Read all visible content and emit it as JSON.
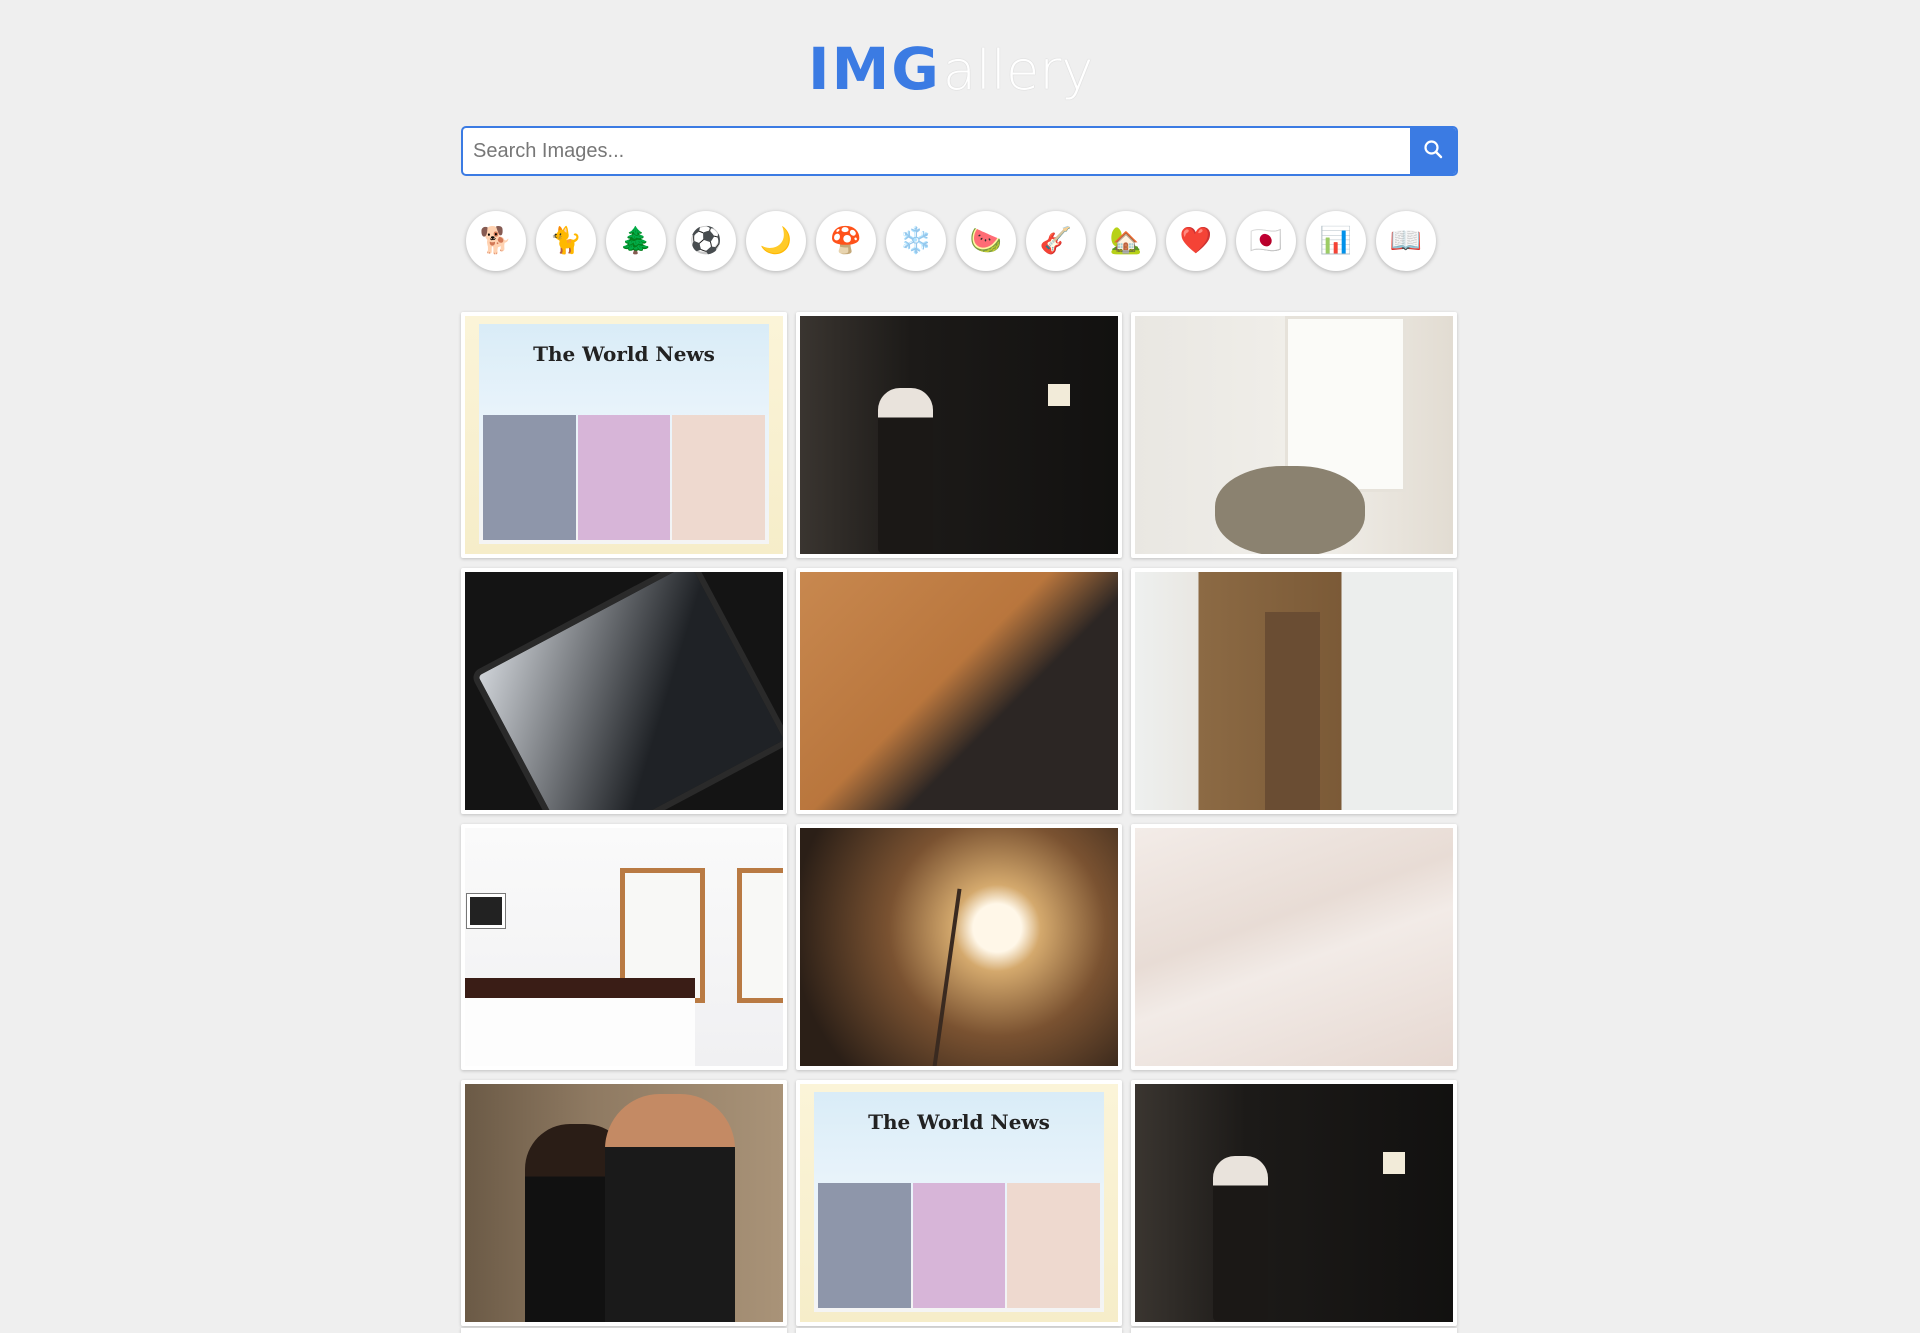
{
  "logo": {
    "part1": "IMG",
    "part2": "allery"
  },
  "search": {
    "placeholder": "Search Images...",
    "value": ""
  },
  "categories": [
    {
      "emoji": "🐕",
      "icon": "dog-icon"
    },
    {
      "emoji": "🐈",
      "icon": "cat-icon"
    },
    {
      "emoji": "🌲",
      "icon": "tree-icon"
    },
    {
      "emoji": "⚽",
      "icon": "soccer-ball-icon"
    },
    {
      "emoji": "🌙",
      "icon": "moon-icon"
    },
    {
      "emoji": "🍄",
      "icon": "mushroom-icon"
    },
    {
      "emoji": "❄️",
      "icon": "snowflake-icon"
    },
    {
      "emoji": "🍉",
      "icon": "watermelon-icon"
    },
    {
      "emoji": "🎸",
      "icon": "guitar-icon"
    },
    {
      "emoji": "🏡",
      "icon": "house-icon"
    },
    {
      "emoji": "❤️",
      "icon": "heart-icon"
    },
    {
      "emoji": "🇯🇵",
      "icon": "japan-flag-icon"
    },
    {
      "emoji": "📊",
      "icon": "bar-chart-icon"
    },
    {
      "emoji": "📖",
      "icon": "book-icon"
    }
  ],
  "gallery": {
    "items": [
      {
        "subject": "world-news-illustration",
        "text": "The World News"
      },
      {
        "subject": "geisha-street"
      },
      {
        "subject": "living-room"
      },
      {
        "subject": "tablet-news"
      },
      {
        "subject": "desert-dune"
      },
      {
        "subject": "apron-on-door"
      },
      {
        "subject": "white-bedroom"
      },
      {
        "subject": "dried-flowers-sunset"
      },
      {
        "subject": "sand-texture"
      },
      {
        "subject": "couple-kiss"
      },
      {
        "subject": "world-news-illustration",
        "text": "The World News"
      },
      {
        "subject": "geisha-street"
      }
    ]
  },
  "colors": {
    "accent": "#3b7be3",
    "background": "#efefef"
  }
}
